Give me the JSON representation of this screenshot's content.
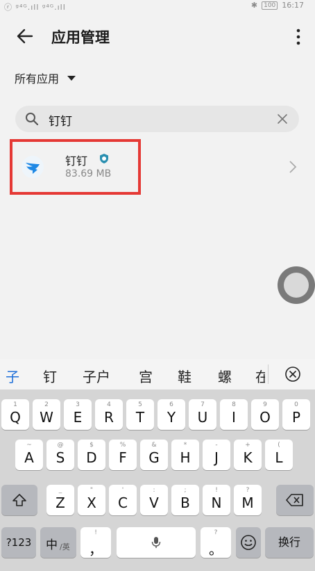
{
  "status": {
    "left": "ⓡ ᵍ⁴ᴳ.ıll ᵍ⁴ᴳ.ıll ",
    "battery": "100",
    "time": "16:17"
  },
  "appbar": {
    "title": "应用管理"
  },
  "filter": {
    "label": "所有应用"
  },
  "search": {
    "value": "钉钉"
  },
  "app": {
    "name": "钉钉",
    "size": "83.69 MB"
  },
  "candidates": [
    "子",
    "钉",
    "子户",
    "宫",
    "鞋",
    "螺",
    "在"
  ],
  "keyboard": {
    "row1": [
      {
        "k": "Q",
        "s": "1"
      },
      {
        "k": "W",
        "s": "2"
      },
      {
        "k": "E",
        "s": "3"
      },
      {
        "k": "R",
        "s": "4"
      },
      {
        "k": "T",
        "s": "5"
      },
      {
        "k": "Y",
        "s": "6"
      },
      {
        "k": "U",
        "s": "7"
      },
      {
        "k": "I",
        "s": "8"
      },
      {
        "k": "O",
        "s": "9"
      },
      {
        "k": "P",
        "s": "0"
      }
    ],
    "row2": [
      {
        "k": "A",
        "s": "~"
      },
      {
        "k": "S",
        "s": "@"
      },
      {
        "k": "D",
        "s": "$"
      },
      {
        "k": "F",
        "s": "%"
      },
      {
        "k": "G",
        "s": "&"
      },
      {
        "k": "H",
        "s": "*"
      },
      {
        "k": "J",
        "s": "-"
      },
      {
        "k": "K",
        "s": "+"
      },
      {
        "k": "L",
        "s": "("
      }
    ],
    "row3": [
      {
        "k": "Z",
        "s": "_"
      },
      {
        "k": "X",
        "s": "\""
      },
      {
        "k": "C",
        "s": "'"
      },
      {
        "k": "V",
        "s": ":"
      },
      {
        "k": "B",
        "s": ";"
      },
      {
        "k": "N",
        "s": "!"
      },
      {
        "k": "M",
        "s": "?"
      }
    ],
    "num_label": "?123",
    "lang_label": "中",
    "lang_sub": "/英",
    "comma_label": "，",
    "comma_sub": "!",
    "period_label": "。",
    "period_sub": "?",
    "enter_label": "换行"
  }
}
